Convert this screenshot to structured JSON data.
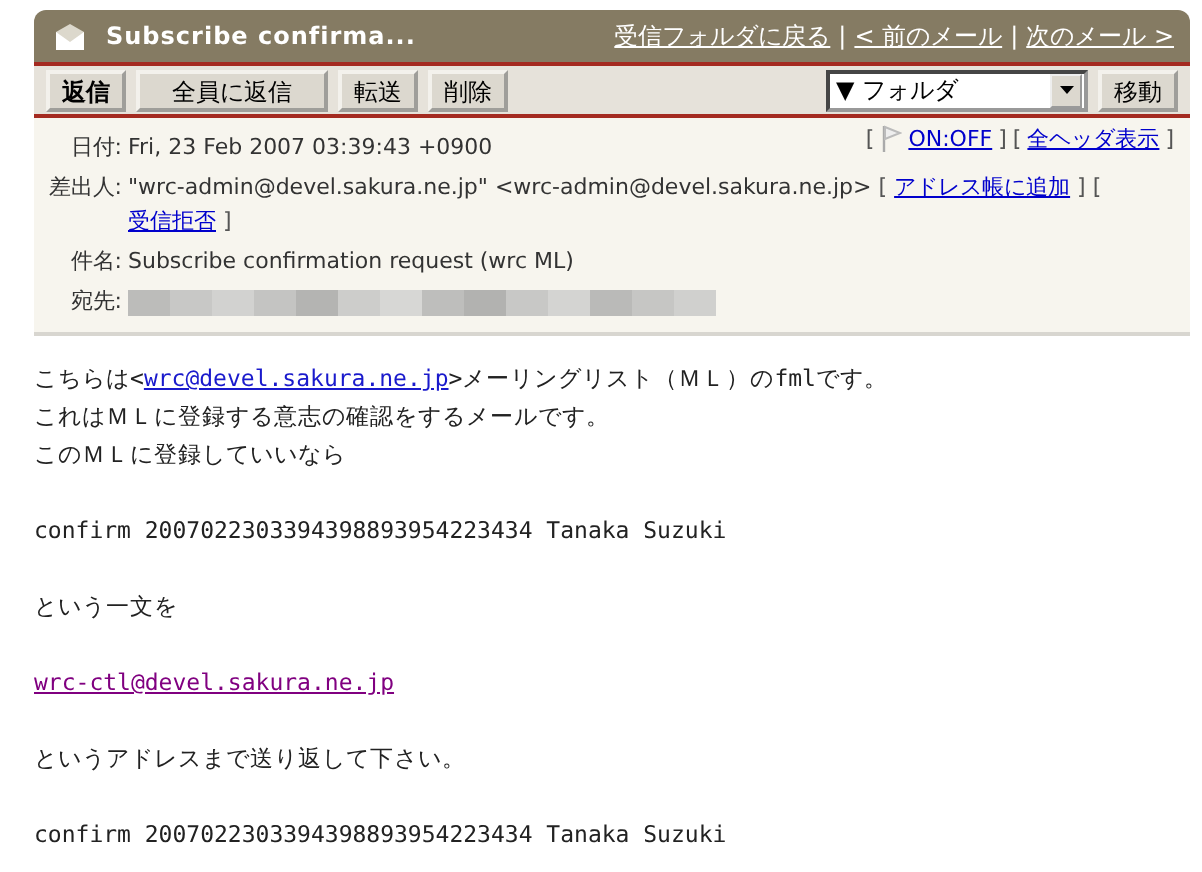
{
  "titlebar": {
    "title": "Subscribe confirma...",
    "separator": "|",
    "links": [
      {
        "label": "受信フォルダに戻る"
      },
      {
        "label": "< 前のメール"
      },
      {
        "label": "次のメール >"
      }
    ]
  },
  "toolbar": {
    "buttons": [
      {
        "label": "返信",
        "bold": true
      },
      {
        "label": "全員に返信",
        "bold": false
      },
      {
        "label": "転送",
        "bold": false
      },
      {
        "label": "削除",
        "bold": false
      }
    ],
    "folder_select": {
      "value": "▼ フォルダ"
    },
    "move_button": {
      "label": "移動"
    }
  },
  "header_actions": [
    {
      "open": "[",
      "label": "ON:OFF",
      "close": "]",
      "kind": "flag"
    },
    {
      "open": "[",
      "label": "全ヘッダ表示",
      "close": "]",
      "kind": "plain"
    }
  ],
  "headers": [
    {
      "label": "日付:",
      "value": "Fri, 23 Feb 2007 03:39:43 +0900"
    },
    {
      "label": "差出人:",
      "value": "\"wrc-admin@devel.sakura.ne.jp\" <wrc-admin@devel.sakura.ne.jp>",
      "actions": [
        {
          "open": "[",
          "label": "アドレス帳に追加",
          "close": "]"
        },
        {
          "open": "[",
          "label": "受信拒否",
          "close": "]"
        }
      ]
    },
    {
      "label": "件名:",
      "value": "Subscribe confirmation request (wrc ML)"
    },
    {
      "label": "宛先:",
      "redacted": true
    }
  ],
  "body": [
    {
      "lines": [
        {
          "before": "こちらは<",
          "link": "wrc@devel.sakura.ne.jp",
          "after": ">メーリングリスト（ＭＬ）のfmlです。",
          "visited": false
        },
        {
          "text": "これはＭＬに登録する意志の確認をするメールです。"
        },
        {
          "text": "このＭＬに登録していいなら"
        }
      ]
    },
    {
      "lines": [
        {
          "text": "confirm 2007022303394398893954223434 Tanaka Suzuki"
        }
      ]
    },
    {
      "lines": [
        {
          "text": "という一文を"
        }
      ]
    },
    {
      "lines": [
        {
          "link": "wrc-ctl@devel.sakura.ne.jp",
          "visited": true
        }
      ]
    },
    {
      "lines": [
        {
          "text": "というアドレスまで送り返して下さい。"
        }
      ]
    },
    {
      "lines": [
        {
          "text": "confirm 2007022303394398893954223434 Tanaka Suzuki"
        }
      ]
    }
  ]
}
